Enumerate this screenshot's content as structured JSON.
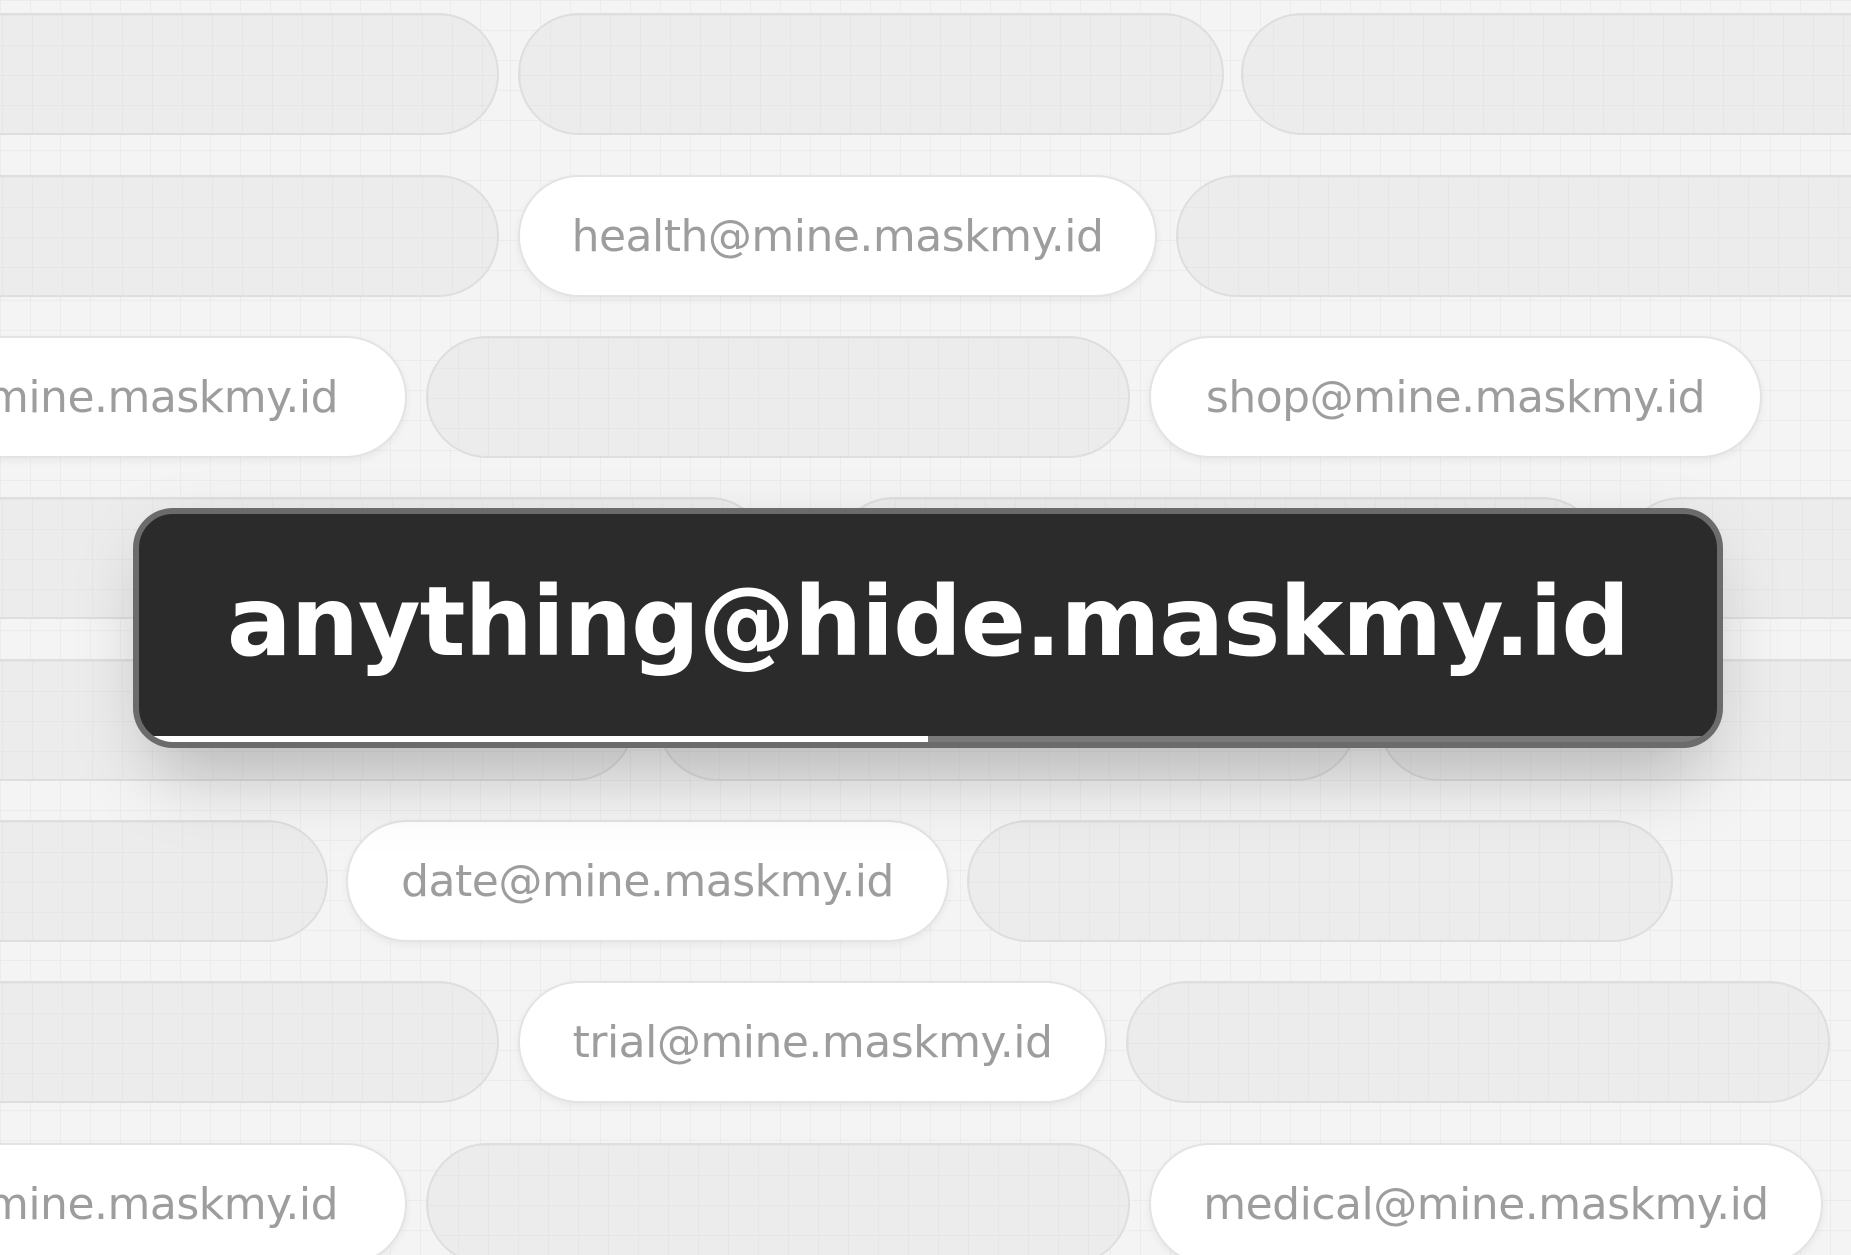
{
  "hero": {
    "address": "anything@hide.maskmy.id",
    "progress": 0.5
  },
  "aliases": {
    "health": "health@mine.maskmy.id",
    "clipped_upper": "mine.maskmy.id",
    "shop": "shop@mine.maskmy.id",
    "date": "date@mine.maskmy.id",
    "trial": "trial@mine.maskmy.id",
    "clipped_lower": "mine.maskmy.id",
    "medical": "medical@mine.maskmy.id"
  },
  "colors": {
    "background": "#f4f4f4",
    "hero_background": "#2b2b2b",
    "hero_text": "#ffffff",
    "alias_text": "#9d9d9d",
    "pill_white": "#ffffff",
    "pill_ghost": "#ececec"
  }
}
